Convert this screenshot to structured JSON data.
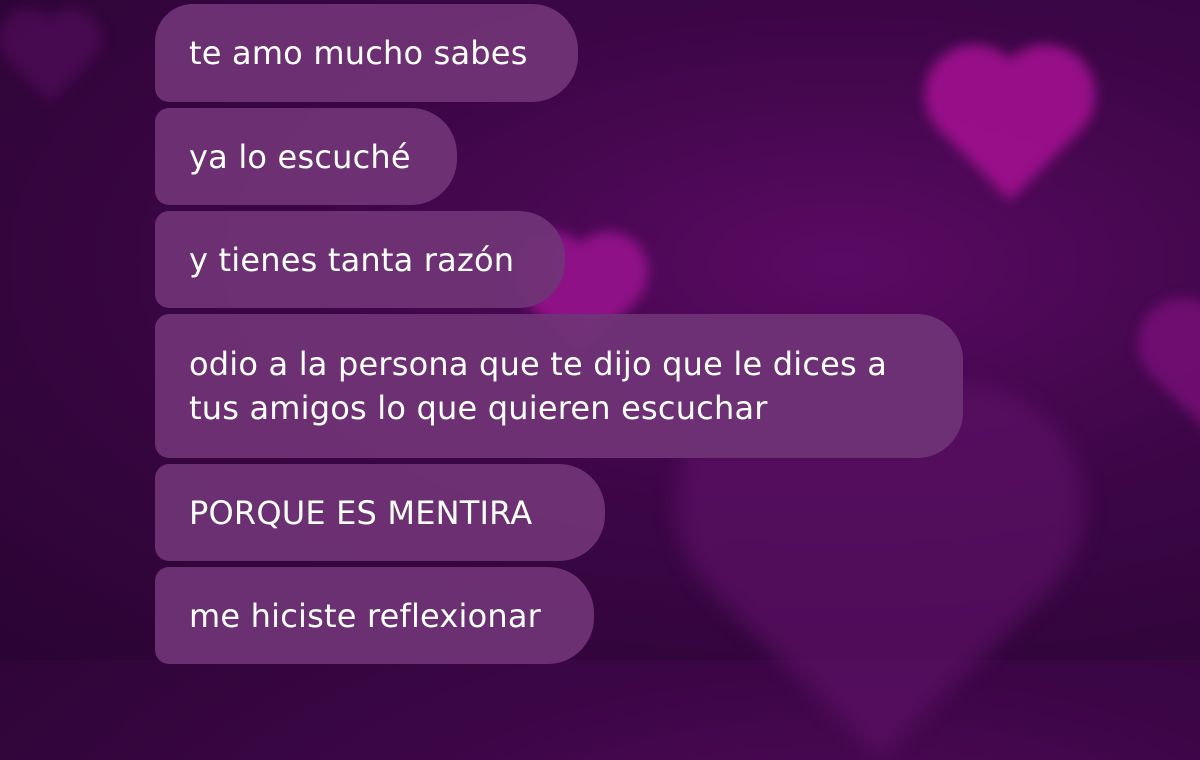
{
  "messages": [
    {
      "text": "te amo mucho sabes"
    },
    {
      "text": "ya lo escuché"
    },
    {
      "text": "y tienes tanta razón"
    },
    {
      "text": "odio a la persona que te dijo que le dices a tus amigos lo que quieren escuchar"
    },
    {
      "text": "PORQUE ES MENTIRA"
    },
    {
      "text": "me hiciste reflexionar"
    }
  ],
  "colors": {
    "background": "#3c0646",
    "bubble": "#703476",
    "text": "#ffffff"
  }
}
